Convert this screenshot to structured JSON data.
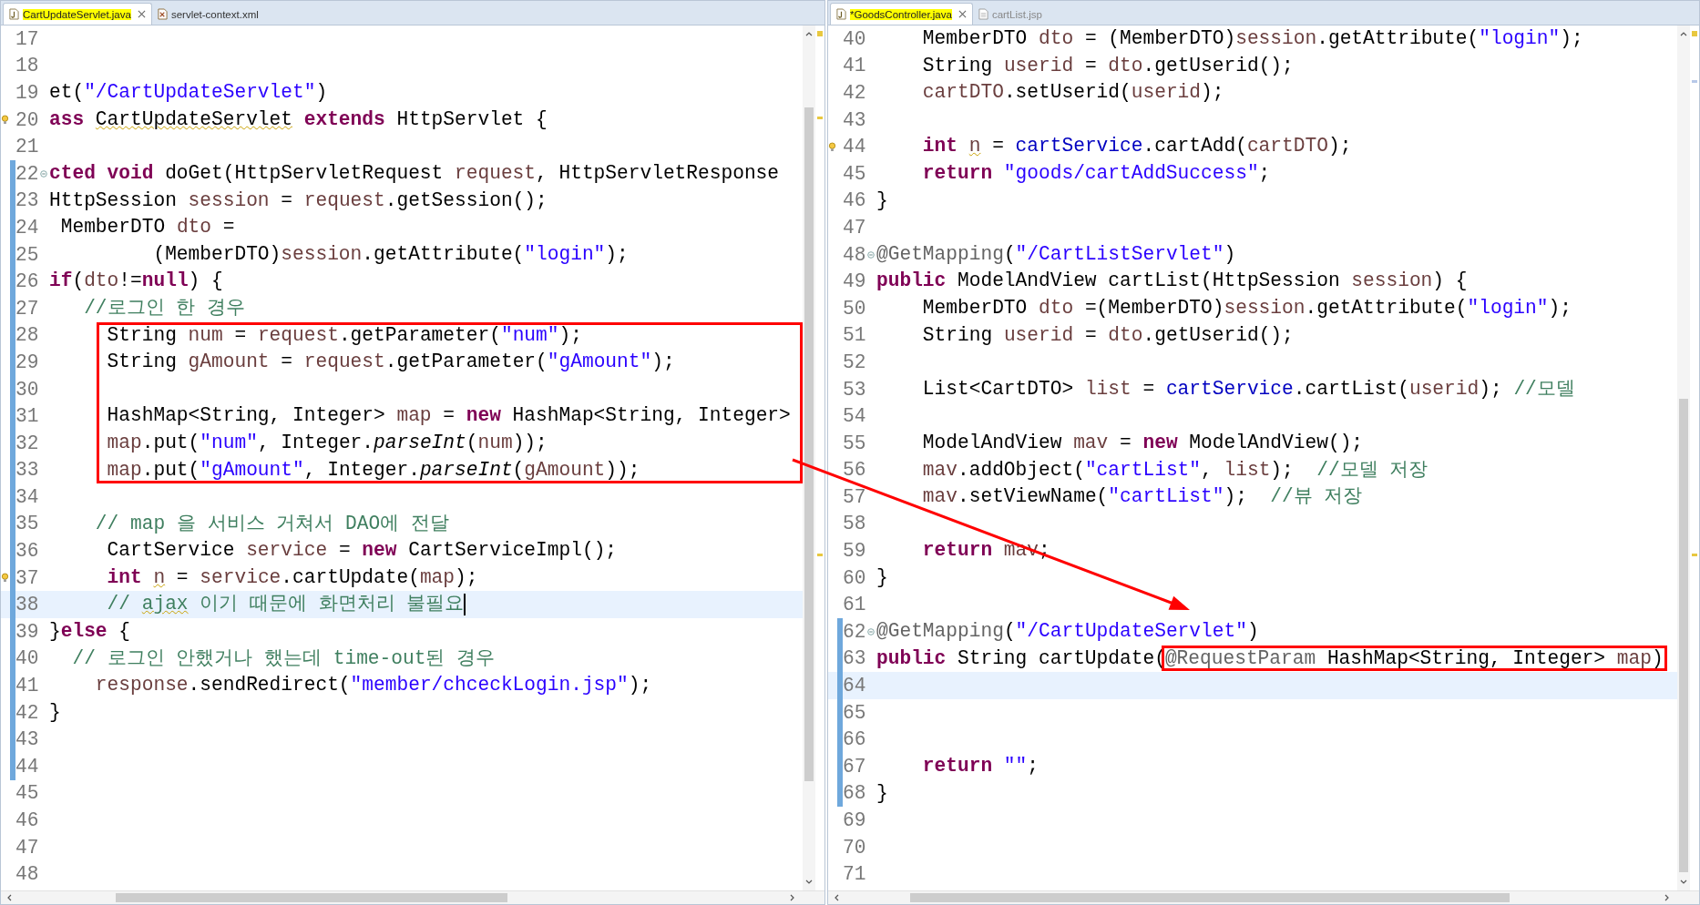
{
  "panels": [
    {
      "tabs": [
        {
          "label": "CartUpdateServlet.java",
          "selected": true,
          "marked": true,
          "kind": "java"
        },
        {
          "label": "servlet-context.xml",
          "selected": false,
          "marked": false,
          "kind": "xml"
        }
      ],
      "lines": [
        {
          "num": "17"
        },
        {
          "num": "18"
        },
        {
          "num": "19",
          "tokens": [
            {
              "kind": "plain",
              "text": "et("
            },
            {
              "kind": "str",
              "text": "\"/CartUpdateServlet\""
            },
            {
              "kind": "plain",
              "text": ")"
            }
          ]
        },
        {
          "num": "20",
          "warning": true,
          "tokens": [
            {
              "kind": "kw",
              "text": "ass "
            },
            {
              "kind": "plain",
              "text": "CartUpdateServlet",
              "squiggle": true
            },
            {
              "kind": "kw",
              "text": " extends"
            },
            {
              "kind": "plain",
              "text": " HttpServlet {"
            }
          ]
        },
        {
          "num": "21"
        },
        {
          "num": "22",
          "foldable": true,
          "changed": true,
          "tokens": [
            {
              "kind": "kw",
              "text": "cted void"
            },
            {
              "kind": "plain",
              "text": " doGet(HttpServletRequest "
            },
            {
              "kind": "var",
              "text": "request"
            },
            {
              "kind": "plain",
              "text": ", HttpServletResponse"
            }
          ]
        },
        {
          "num": "23",
          "changed": true,
          "tokens": [
            {
              "kind": "plain",
              "text": "HttpSession "
            },
            {
              "kind": "var",
              "text": "session"
            },
            {
              "kind": "plain",
              "text": " = "
            },
            {
              "kind": "var",
              "text": "request"
            },
            {
              "kind": "plain",
              "text": ".getSession();"
            }
          ]
        },
        {
          "num": "24",
          "changed": true,
          "tokens": [
            {
              "kind": "plain",
              "text": " MemberDTO "
            },
            {
              "kind": "var",
              "text": "dto"
            },
            {
              "kind": "plain",
              "text": " ="
            }
          ]
        },
        {
          "num": "25",
          "changed": true,
          "tokens": [
            {
              "kind": "plain",
              "text": "         (MemberDTO)"
            },
            {
              "kind": "var",
              "text": "session"
            },
            {
              "kind": "plain",
              "text": ".getAttribute("
            },
            {
              "kind": "str",
              "text": "\"login\""
            },
            {
              "kind": "plain",
              "text": ");"
            }
          ]
        },
        {
          "num": "26",
          "changed": true,
          "tokens": [
            {
              "kind": "kw",
              "text": "if"
            },
            {
              "kind": "plain",
              "text": "("
            },
            {
              "kind": "var",
              "text": "dto"
            },
            {
              "kind": "plain",
              "text": "!="
            },
            {
              "kind": "kw",
              "text": "null"
            },
            {
              "kind": "plain",
              "text": ") {"
            }
          ]
        },
        {
          "num": "27",
          "changed": true,
          "tokens": [
            {
              "kind": "comment",
              "text": "   //로그인 한 경우"
            }
          ]
        },
        {
          "num": "28",
          "changed": true,
          "boxed": true,
          "tokens": [
            {
              "kind": "plain",
              "text": "     String "
            },
            {
              "kind": "var",
              "text": "num"
            },
            {
              "kind": "plain",
              "text": " = "
            },
            {
              "kind": "var",
              "text": "request"
            },
            {
              "kind": "plain",
              "text": ".getParameter("
            },
            {
              "kind": "str",
              "text": "\"num\""
            },
            {
              "kind": "plain",
              "text": ");"
            }
          ]
        },
        {
          "num": "29",
          "changed": true,
          "boxed": true,
          "tokens": [
            {
              "kind": "plain",
              "text": "     String "
            },
            {
              "kind": "var",
              "text": "gAmount"
            },
            {
              "kind": "plain",
              "text": " = "
            },
            {
              "kind": "var",
              "text": "request"
            },
            {
              "kind": "plain",
              "text": ".getParameter("
            },
            {
              "kind": "str",
              "text": "\"gAmount\""
            },
            {
              "kind": "plain",
              "text": ");"
            }
          ]
        },
        {
          "num": "30",
          "changed": true,
          "boxed": true
        },
        {
          "num": "31",
          "changed": true,
          "boxed": true,
          "tokens": [
            {
              "kind": "plain",
              "text": "     HashMap<String, Integer> "
            },
            {
              "kind": "var",
              "text": "map"
            },
            {
              "kind": "plain",
              "text": " = "
            },
            {
              "kind": "kw",
              "text": "new"
            },
            {
              "kind": "plain",
              "text": " HashMap<String, Integer>"
            }
          ]
        },
        {
          "num": "32",
          "changed": true,
          "boxed": true,
          "tokens": [
            {
              "kind": "var",
              "text": "     map"
            },
            {
              "kind": "plain",
              "text": ".put("
            },
            {
              "kind": "str",
              "text": "\"num\""
            },
            {
              "kind": "plain",
              "text": ", Integer."
            },
            {
              "kind": "method",
              "text": "parseInt"
            },
            {
              "kind": "plain",
              "text": "("
            },
            {
              "kind": "var",
              "text": "num"
            },
            {
              "kind": "plain",
              "text": "));"
            }
          ]
        },
        {
          "num": "33",
          "changed": true,
          "boxed": true,
          "tokens": [
            {
              "kind": "var",
              "text": "     map"
            },
            {
              "kind": "plain",
              "text": ".put("
            },
            {
              "kind": "str",
              "text": "\"gAmount\""
            },
            {
              "kind": "plain",
              "text": ", Integer."
            },
            {
              "kind": "method",
              "text": "parseInt"
            },
            {
              "kind": "plain",
              "text": "("
            },
            {
              "kind": "var",
              "text": "gAmount"
            },
            {
              "kind": "plain",
              "text": "));"
            }
          ]
        },
        {
          "num": "34",
          "changed": true
        },
        {
          "num": "35",
          "changed": true,
          "tokens": [
            {
              "kind": "comment",
              "text": "    // map 을 서비스 거쳐서 DAO에 전달"
            }
          ]
        },
        {
          "num": "36",
          "changed": true,
          "tokens": [
            {
              "kind": "plain",
              "text": "     CartService "
            },
            {
              "kind": "var",
              "text": "service"
            },
            {
              "kind": "plain",
              "text": " = "
            },
            {
              "kind": "kw",
              "text": "new"
            },
            {
              "kind": "plain",
              "text": " CartServiceImpl();"
            }
          ]
        },
        {
          "num": "37",
          "warning": true,
          "changed": true,
          "tokens": [
            {
              "kind": "kw",
              "text": "     int "
            },
            {
              "kind": "var",
              "text": "n",
              "squiggle": true
            },
            {
              "kind": "plain",
              "text": " = "
            },
            {
              "kind": "var",
              "text": "service"
            },
            {
              "kind": "plain",
              "text": ".cartUpdate("
            },
            {
              "kind": "var",
              "text": "map"
            },
            {
              "kind": "plain",
              "text": ");"
            }
          ]
        },
        {
          "num": "38",
          "changed": true,
          "current": true,
          "cursor": true,
          "tokens": [
            {
              "kind": "comment",
              "text": "     // "
            },
            {
              "kind": "comment",
              "text": "ajax",
              "squiggle": true
            },
            {
              "kind": "comment",
              "text": " 이기 때문에 화면처리 불필요"
            }
          ]
        },
        {
          "num": "39",
          "changed": true,
          "tokens": [
            {
              "kind": "plain",
              "text": "}"
            },
            {
              "kind": "kw",
              "text": "else"
            },
            {
              "kind": "plain",
              "text": " {"
            }
          ]
        },
        {
          "num": "40",
          "changed": true,
          "tokens": [
            {
              "kind": "comment",
              "text": "  // 로그인 안했거나 했는데 time-out된 경우"
            }
          ]
        },
        {
          "num": "41",
          "changed": true,
          "tokens": [
            {
              "kind": "var",
              "text": "    response"
            },
            {
              "kind": "plain",
              "text": ".sendRedirect("
            },
            {
              "kind": "str",
              "text": "\"member/chceckLogin.jsp\""
            },
            {
              "kind": "plain",
              "text": ");"
            }
          ]
        },
        {
          "num": "42",
          "changed": true,
          "tokens": [
            {
              "kind": "plain",
              "text": "}"
            }
          ]
        },
        {
          "num": "43",
          "changed": true
        },
        {
          "num": "44",
          "changed": true
        },
        {
          "num": "45"
        },
        {
          "num": "46"
        },
        {
          "num": "47"
        },
        {
          "num": "48"
        }
      ]
    },
    {
      "tabs": [
        {
          "label": "*GoodsController.java",
          "selected": true,
          "marked": true,
          "kind": "java"
        },
        {
          "label": "cartList.jsp",
          "selected": false,
          "marked": false,
          "kind": "jsp"
        }
      ],
      "lines": [
        {
          "num": "40",
          "tokens": [
            {
              "kind": "plain",
              "text": "    MemberDTO "
            },
            {
              "kind": "var",
              "text": "dto"
            },
            {
              "kind": "plain",
              "text": " = (MemberDTO)"
            },
            {
              "kind": "var",
              "text": "session"
            },
            {
              "kind": "plain",
              "text": ".getAttribute("
            },
            {
              "kind": "str",
              "text": "\"login\""
            },
            {
              "kind": "plain",
              "text": ");"
            }
          ]
        },
        {
          "num": "41",
          "tokens": [
            {
              "kind": "plain",
              "text": "    String "
            },
            {
              "kind": "var",
              "text": "userid"
            },
            {
              "kind": "plain",
              "text": " = "
            },
            {
              "kind": "var",
              "text": "dto"
            },
            {
              "kind": "plain",
              "text": ".getUserid();"
            }
          ]
        },
        {
          "num": "42",
          "tokens": [
            {
              "kind": "var",
              "text": "    cartDTO"
            },
            {
              "kind": "plain",
              "text": ".setUserid("
            },
            {
              "kind": "var",
              "text": "userid"
            },
            {
              "kind": "plain",
              "text": ");"
            }
          ]
        },
        {
          "num": "43"
        },
        {
          "num": "44",
          "warning": true,
          "tokens": [
            {
              "kind": "kw",
              "text": "    int "
            },
            {
              "kind": "var",
              "text": "n",
              "squiggle": true
            },
            {
              "kind": "plain",
              "text": " = "
            },
            {
              "kind": "field",
              "text": "cartService"
            },
            {
              "kind": "plain",
              "text": ".cartAdd("
            },
            {
              "kind": "var",
              "text": "cartDTO"
            },
            {
              "kind": "plain",
              "text": ");"
            }
          ]
        },
        {
          "num": "45",
          "tokens": [
            {
              "kind": "kw",
              "text": "    return"
            },
            {
              "kind": "str",
              "text": " \"goods/cartAddSuccess\""
            },
            {
              "kind": "plain",
              "text": ";"
            }
          ]
        },
        {
          "num": "46",
          "tokens": [
            {
              "kind": "plain",
              "text": "}"
            }
          ]
        },
        {
          "num": "47"
        },
        {
          "num": "48",
          "foldable": true,
          "tokens": [
            {
              "kind": "ann",
              "text": "@GetMapping"
            },
            {
              "kind": "plain",
              "text": "("
            },
            {
              "kind": "str",
              "text": "\"/CartListServlet\""
            },
            {
              "kind": "plain",
              "text": ")"
            }
          ]
        },
        {
          "num": "49",
          "tokens": [
            {
              "kind": "kw",
              "text": "public"
            },
            {
              "kind": "plain",
              "text": " ModelAndView cartList(HttpSession "
            },
            {
              "kind": "var",
              "text": "session"
            },
            {
              "kind": "plain",
              "text": ") {"
            }
          ]
        },
        {
          "num": "50",
          "tokens": [
            {
              "kind": "plain",
              "text": "    MemberDTO "
            },
            {
              "kind": "var",
              "text": "dto"
            },
            {
              "kind": "plain",
              "text": " =(MemberDTO)"
            },
            {
              "kind": "var",
              "text": "session"
            },
            {
              "kind": "plain",
              "text": ".getAttribute("
            },
            {
              "kind": "str",
              "text": "\"login\""
            },
            {
              "kind": "plain",
              "text": ");"
            }
          ]
        },
        {
          "num": "51",
          "tokens": [
            {
              "kind": "plain",
              "text": "    String "
            },
            {
              "kind": "var",
              "text": "userid"
            },
            {
              "kind": "plain",
              "text": " = "
            },
            {
              "kind": "var",
              "text": "dto"
            },
            {
              "kind": "plain",
              "text": ".getUserid();"
            }
          ]
        },
        {
          "num": "52"
        },
        {
          "num": "53",
          "tokens": [
            {
              "kind": "plain",
              "text": "    List<CartDTO> "
            },
            {
              "kind": "var",
              "text": "list"
            },
            {
              "kind": "plain",
              "text": " = "
            },
            {
              "kind": "field",
              "text": "cartService"
            },
            {
              "kind": "plain",
              "text": ".cartList("
            },
            {
              "kind": "var",
              "text": "userid"
            },
            {
              "kind": "plain",
              "text": "); "
            },
            {
              "kind": "comment",
              "text": "//모델"
            }
          ]
        },
        {
          "num": "54"
        },
        {
          "num": "55",
          "tokens": [
            {
              "kind": "plain",
              "text": "    ModelAndView "
            },
            {
              "kind": "var",
              "text": "mav"
            },
            {
              "kind": "plain",
              "text": " = "
            },
            {
              "kind": "kw",
              "text": "new"
            },
            {
              "kind": "plain",
              "text": " ModelAndView();"
            }
          ]
        },
        {
          "num": "56",
          "tokens": [
            {
              "kind": "var",
              "text": "    mav"
            },
            {
              "kind": "plain",
              "text": ".addObject("
            },
            {
              "kind": "str",
              "text": "\"cartList\""
            },
            {
              "kind": "plain",
              "text": ", "
            },
            {
              "kind": "var",
              "text": "list"
            },
            {
              "kind": "plain",
              "text": ");  "
            },
            {
              "kind": "comment",
              "text": "//모델 저장"
            }
          ]
        },
        {
          "num": "57",
          "tokens": [
            {
              "kind": "var",
              "text": "    mav"
            },
            {
              "kind": "plain",
              "text": ".setViewName("
            },
            {
              "kind": "str",
              "text": "\"cartList\""
            },
            {
              "kind": "plain",
              "text": ");  "
            },
            {
              "kind": "comment",
              "text": "//뷰 저장"
            }
          ]
        },
        {
          "num": "58"
        },
        {
          "num": "59",
          "tokens": [
            {
              "kind": "kw",
              "text": "    return"
            },
            {
              "kind": "var",
              "text": " mav"
            },
            {
              "kind": "plain",
              "text": ";"
            }
          ]
        },
        {
          "num": "60",
          "tokens": [
            {
              "kind": "plain",
              "text": "}"
            }
          ]
        },
        {
          "num": "61"
        },
        {
          "num": "62",
          "foldable": true,
          "changed": true,
          "tokens": [
            {
              "kind": "ann",
              "text": "@GetMapping"
            },
            {
              "kind": "plain",
              "text": "("
            },
            {
              "kind": "str",
              "text": "\"/CartUpdateServlet\""
            },
            {
              "kind": "plain",
              "text": ")"
            }
          ]
        },
        {
          "num": "63",
          "changed": true,
          "tokens": [
            {
              "kind": "kw",
              "text": "public"
            },
            {
              "kind": "plain",
              "text": " String cartUpdate("
            },
            {
              "boxed": true,
              "parts": [
                {
                  "kind": "ann",
                  "text": "@RequestParam"
                },
                {
                  "kind": "plain",
                  "text": " HashMap<String, Integer> "
                },
                {
                  "kind": "var",
                  "text": "map"
                },
                {
                  "kind": "plain",
                  "text": ")"
                }
              ]
            }
          ]
        },
        {
          "num": "64",
          "changed": true,
          "current": true
        },
        {
          "num": "65",
          "changed": true
        },
        {
          "num": "66",
          "changed": true
        },
        {
          "num": "67",
          "changed": true,
          "tokens": [
            {
              "kind": "kw",
              "text": "    return"
            },
            {
              "kind": "str",
              "text": " \"\""
            },
            {
              "kind": "plain",
              "text": ";"
            }
          ]
        },
        {
          "num": "68",
          "changed": true,
          "tokens": [
            {
              "kind": "plain",
              "text": "}"
            }
          ]
        },
        {
          "num": "69"
        },
        {
          "num": "70"
        },
        {
          "num": "71"
        }
      ]
    }
  ]
}
